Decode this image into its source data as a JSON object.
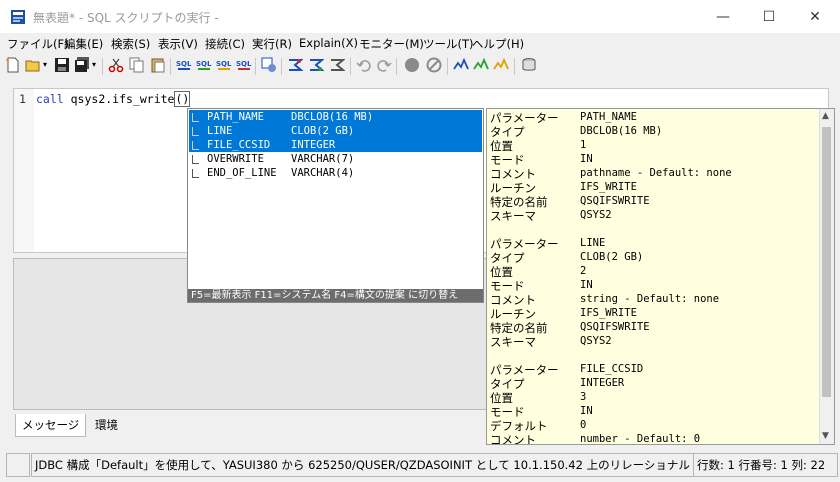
{
  "window": {
    "title": "無表題* - SQL スクリプトの実行 -",
    "minimize": "—",
    "maximize": "☐",
    "close": "✕"
  },
  "menu": {
    "items": [
      "ファイル(F)",
      "編集(E)",
      "検索(S)",
      "表示(V)",
      "接続(C)",
      "実行(R)",
      "Explain(X)",
      "モニター(M)",
      "ツール(T)",
      "ヘルプ(H)"
    ]
  },
  "toolbar": {
    "icons": [
      "new-file-icon",
      "open-folder-icon",
      "save-icon",
      "save-all-icon",
      "cut-icon",
      "copy-icon",
      "paste-icon",
      "run-sql-icon",
      "run-sql-selected-icon",
      "run-sql-from-cursor-icon",
      "run-sql-all-icon",
      "run-options-icon",
      "explain-icon",
      "visual-explain-icon",
      "explain-options-icon",
      "undo-icon",
      "redo-icon",
      "stop-icon",
      "cancel-icon",
      "monitor-icon",
      "monitor-graph-icon",
      "monitor-settings-icon",
      "db-tools-icon"
    ]
  },
  "editor": {
    "line_number": "1",
    "keyword": "call",
    "code_text": " qsys2.ifs_write",
    "paren": "()"
  },
  "autocomplete": {
    "rows": [
      {
        "name": "PATH_NAME",
        "type": "DBCLOB(16 MB)",
        "selected": true
      },
      {
        "name": "LINE",
        "type": "CLOB(2 GB)",
        "selected": true
      },
      {
        "name": "FILE_CCSID",
        "type": "INTEGER",
        "selected": true
      },
      {
        "name": "OVERWRITE",
        "type": "VARCHAR(7)",
        "selected": false
      },
      {
        "name": "END_OF_LINE",
        "type": "VARCHAR(4)",
        "selected": false
      }
    ],
    "footer": "F5=最新表示  F11=システム名  F4=構文の提案 に切り替え"
  },
  "detail": {
    "labels": {
      "parameter": "パラメーター",
      "type": "タイプ",
      "position": "位置",
      "mode": "モード",
      "comment": "コメント",
      "routine": "ルーチン",
      "specific": "特定の名前",
      "schema": "スキーマ",
      "default": "デフォルト"
    },
    "block1": {
      "parameter": "PATH_NAME",
      "type": "DBCLOB(16 MB)",
      "position": "1",
      "mode": "IN",
      "comment": "pathname - Default: none",
      "routine": "IFS_WRITE",
      "specific": "QSQIFSWRITE",
      "schema": "QSYS2"
    },
    "block2": {
      "parameter": "LINE",
      "type": "CLOB(2 GB)",
      "position": "2",
      "mode": "IN",
      "comment": "string - Default: none",
      "routine": "IFS_WRITE",
      "specific": "QSQIFSWRITE",
      "schema": "QSYS2"
    },
    "block3": {
      "parameter": "FILE_CCSID",
      "type": "INTEGER",
      "position": "3",
      "mode": "IN",
      "default": "0",
      "comment": "number - Default: 0"
    }
  },
  "message_tabs": [
    "メッセージ",
    "環境"
  ],
  "status": {
    "connection": "JDBC 構成「Default」を使用して、YASUI380 から 625250/QUSER/QZDASOINIT として 10.1.150.42 上のリレーショナル・データベース Lpa",
    "rows": "行数: 1",
    "position": "行番号: 1  列: 22"
  }
}
